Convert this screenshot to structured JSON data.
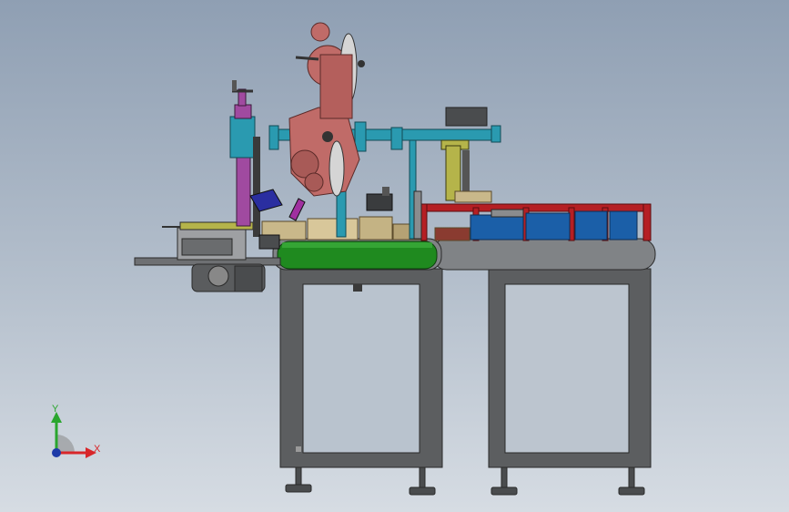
{
  "triad": {
    "x_label": "X",
    "y_label": "Y",
    "x_color": "#d8262a",
    "y_color": "#2aa62e",
    "z_color": "#1d3aa8"
  },
  "colors": {
    "background_top": "#8f9fb3",
    "background_bottom": "#d6dce3",
    "frame": "#5a5c5e",
    "conveyor_belt": "#1f8a1f",
    "tabletop": "#7d8084",
    "guard_rail": "#b51f24",
    "blue_boxes": "#1b5fa8",
    "teal_shaft": "#2a9ab0",
    "salmon_mechanism": "#c06b68",
    "purple_column": "#a04aa0",
    "olive_stand": "#b5b44a"
  }
}
